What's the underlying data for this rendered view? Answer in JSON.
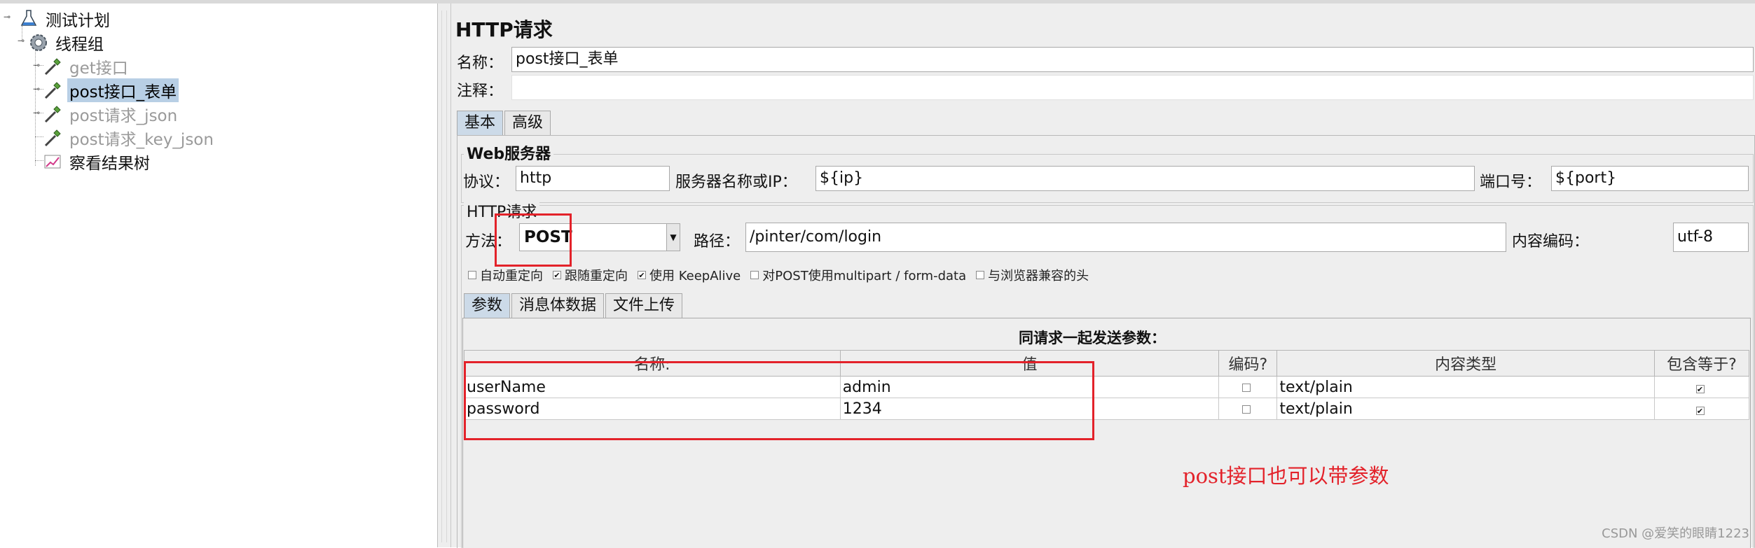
{
  "tree": {
    "items": [
      {
        "label": "测试计划"
      },
      {
        "label": "线程组"
      },
      {
        "label": "get接口"
      },
      {
        "label": "post接口_表单"
      },
      {
        "label": "post请求_json"
      },
      {
        "label": "post请求_key_json"
      },
      {
        "label": "察看结果树"
      }
    ]
  },
  "panel": {
    "title": "HTTP请求",
    "name_label": "名称：",
    "name_value": "post接口_表单",
    "comment_label": "注释：",
    "comment_value": "",
    "tabs": [
      {
        "label": "基本"
      },
      {
        "label": "高级"
      }
    ],
    "web_server": {
      "legend": "Web服务器",
      "protocol_label": "协议：",
      "protocol_value": "http",
      "server_label": "服务器名称或IP：",
      "server_value": "${ip}",
      "port_label": "端口号：",
      "port_value": "${port}"
    },
    "http_request": {
      "legend": "HTTP请求",
      "method_label": "方法：",
      "method_value": "POST",
      "path_label": "路径：",
      "path_value": "/pinter/com/login",
      "encoding_label": "内容编码：",
      "encoding_value": "utf-8"
    },
    "options": [
      {
        "label": "自动重定向",
        "checked": false
      },
      {
        "label": "跟随重定向",
        "checked": true
      },
      {
        "label": "使用 KeepAlive",
        "checked": true
      },
      {
        "label": "对POST使用multipart / form-data",
        "checked": false
      },
      {
        "label": "与浏览器兼容的头",
        "checked": false
      }
    ],
    "sub_tabs": [
      {
        "label": "参数"
      },
      {
        "label": "消息体数据"
      },
      {
        "label": "文件上传"
      }
    ],
    "params": {
      "caption": "同请求一起发送参数：",
      "columns": [
        "名称:",
        "值",
        "编码?",
        "内容类型",
        "包含等于?"
      ],
      "rows": [
        {
          "name": "userName",
          "value": "admin",
          "encode": false,
          "content_type": "text/plain",
          "include_equals": true
        },
        {
          "name": "password",
          "value": "1234",
          "encode": false,
          "content_type": "text/plain",
          "include_equals": true
        }
      ]
    },
    "annotation": "post接口也可以带参数"
  },
  "watermark": "CSDN @爱笑的眼睛1223"
}
